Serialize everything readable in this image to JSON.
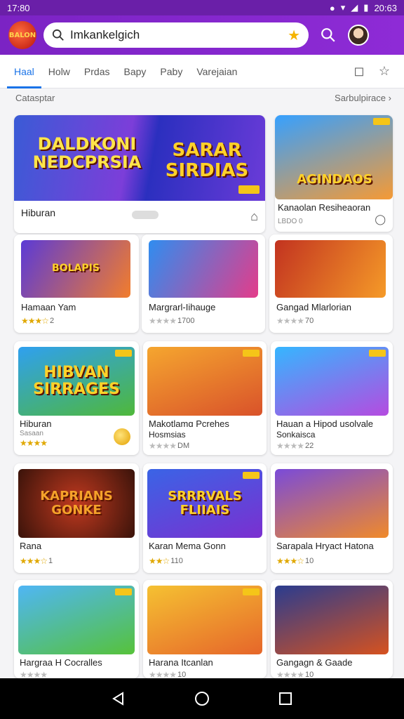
{
  "status_bar": {
    "time": "17:80",
    "right": "20:63"
  },
  "app_bar": {
    "logo_text": "BALON",
    "search_value": "Imkankelgich"
  },
  "tabs": [
    {
      "label": "Haal",
      "active": true
    },
    {
      "label": "Holw"
    },
    {
      "label": "Prdas"
    },
    {
      "label": "Bapy"
    },
    {
      "label": "Paby"
    },
    {
      "label": "Varejaian"
    }
  ],
  "section": {
    "title": "Catasptar",
    "link": "Saɾbulpirace"
  },
  "featured": {
    "banner_left": "DALDKONI NEDCPRSIA",
    "banner_right": "SARAR SIRDIAS",
    "name": "Hiburan"
  },
  "side_featured": {
    "banner": "AGINDAOS",
    "name": "Kanaolan Resiheaoran",
    "sub": "LBDO 0"
  },
  "games": [
    {
      "banner": "BOLAPIS",
      "name": "Hamaan Yam",
      "stars": "★★★☆",
      "count": "2"
    },
    {
      "banner": "",
      "name": "Margrarl-Iihauge",
      "stars": "★★★★",
      "count": "1700",
      "gray": true
    },
    {
      "banner": "",
      "name": "Gangad Mlarlorian",
      "stars": "★★★★",
      "count": "70",
      "gray": true
    },
    {
      "banner": "HIBVAN SIRRAGES",
      "name": "Hiburan",
      "sub": "Sasaan",
      "stars": "★★★★",
      "count": ""
    },
    {
      "banner": "",
      "name": "Makotlamɑ Pcrehes",
      "sub": "Hosmsias",
      "stars": "★★★★",
      "count": "DM",
      "gray": true
    },
    {
      "banner": "",
      "name": "Hauan a Hipod usolvale",
      "sub": "Sonkaisca",
      "stars": "★★★★",
      "count": "22",
      "gray": true
    },
    {
      "banner": "KAPRIANS GONKE",
      "name": "Rana",
      "stars": "★★★☆",
      "count": "1"
    },
    {
      "banner": "SRRRVALS FLIIAIS",
      "name": "Karan Mema Gonn",
      "stars": "★★☆",
      "count": "110"
    },
    {
      "banner": "",
      "name": "Sarapala Hryact Hatona",
      "stars": "★★★☆",
      "count": "10"
    },
    {
      "banner": "",
      "name": "Hargraa H Cocralles",
      "stars": "★★★★",
      "count": "",
      "gray": true
    },
    {
      "banner": "",
      "name": "Harana Itcanlan",
      "stars": "★★★★",
      "count": "10",
      "gray": true
    },
    {
      "banner": "",
      "name": "Gangagn & Gaade",
      "stars": "★★★★",
      "count": "10",
      "gray": true
    }
  ],
  "colors": {
    "brand": "#7b23c4",
    "accent": "#1a73e8",
    "star": "#e0a800"
  }
}
